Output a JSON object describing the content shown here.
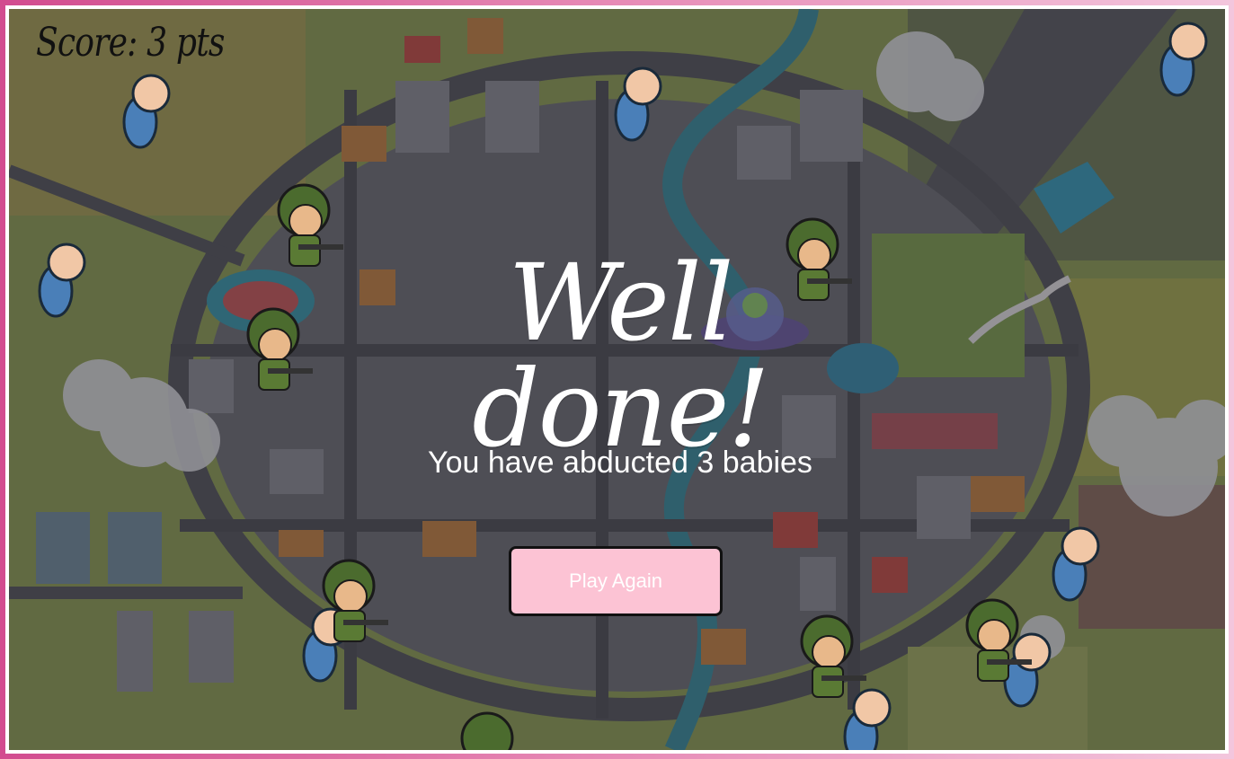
{
  "hud": {
    "score_text": "Score: 3 pts"
  },
  "overlay": {
    "title": "Well done!",
    "message": "You have abducted 3 babies",
    "play_again_label": "Play Again"
  },
  "colors": {
    "button_bg": "#fcc3d4",
    "frame_gradient_left": "#d24c8f",
    "frame_gradient_right": "#f3c6dd"
  }
}
